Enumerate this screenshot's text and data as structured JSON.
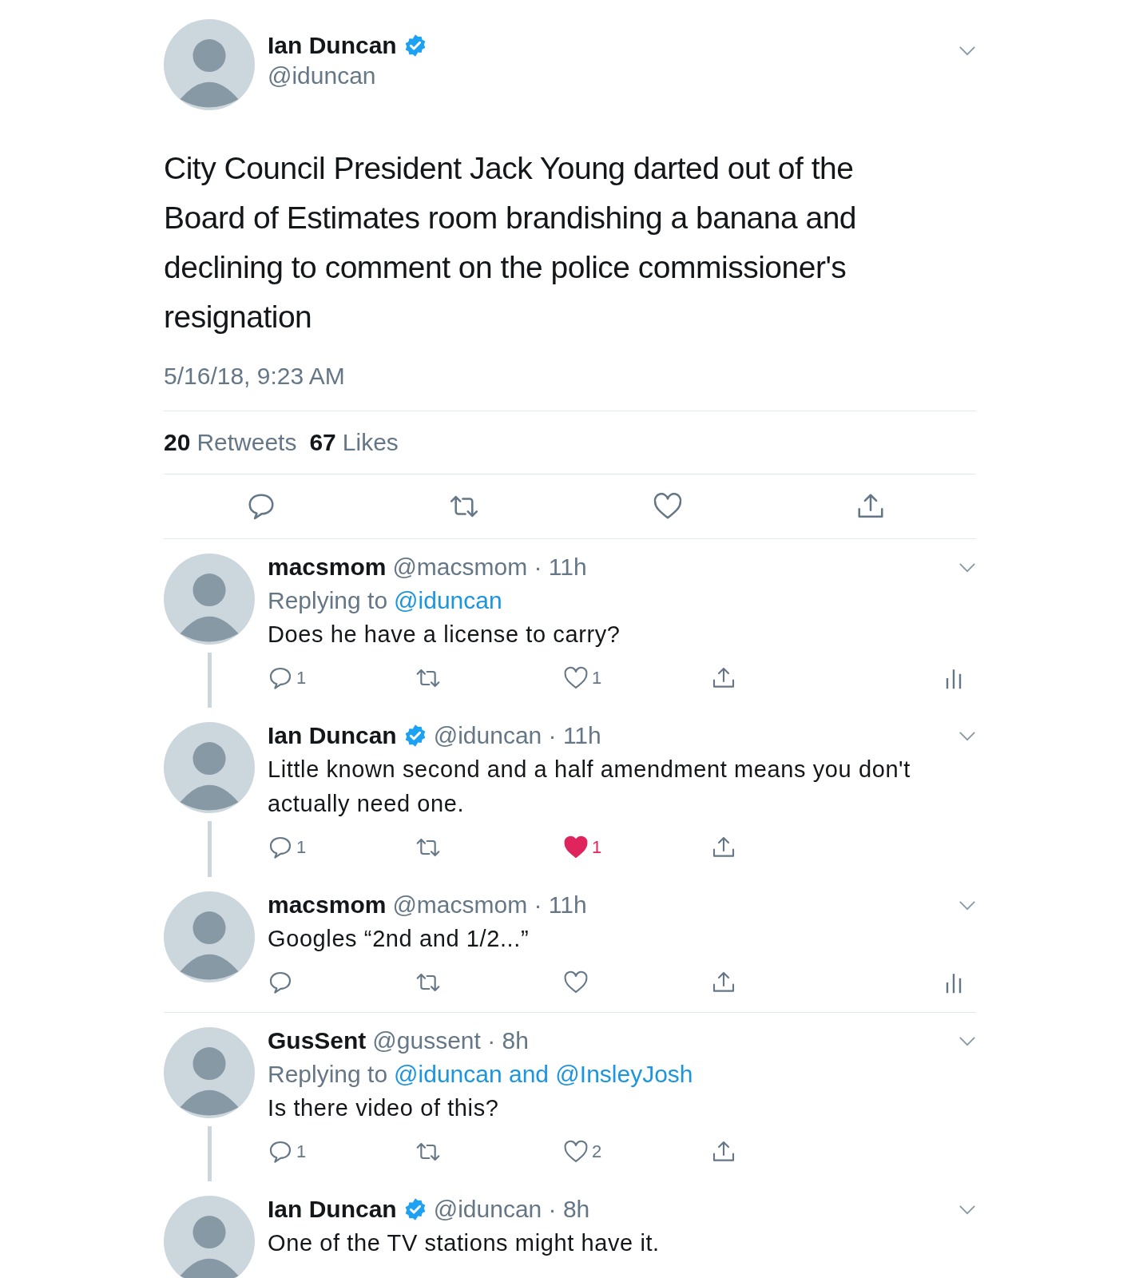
{
  "main_tweet": {
    "name": "Ian Duncan",
    "verified": true,
    "handle": "@iduncan",
    "text": "City Council President Jack Young darted out of the Board of Estimates room brandishing a banana and declining to comment on the police commissioner's resignation",
    "timestamp": "5/16/18, 9:23 AM",
    "stats": [
      {
        "count": "20",
        "label": "Retweets"
      },
      {
        "count": "67",
        "label": "Likes"
      }
    ],
    "actions": [
      {
        "kind": "reply"
      },
      {
        "kind": "retweet"
      },
      {
        "kind": "like",
        "liked": false
      },
      {
        "kind": "share"
      }
    ]
  },
  "threads": [
    {
      "tweets": [
        {
          "name": "macsmom",
          "verified": false,
          "meta": "@macsmom · 11h",
          "replying_to": {
            "prefix": "Replying to",
            "users": "@iduncan"
          },
          "text": "Does he have a license to carry?",
          "analytics": true,
          "actions": [
            {
              "kind": "reply",
              "count": "1"
            },
            {
              "kind": "retweet"
            },
            {
              "kind": "like",
              "liked": false,
              "count": "1"
            },
            {
              "kind": "share"
            }
          ]
        },
        {
          "name": "Ian Duncan",
          "verified": true,
          "meta": "@iduncan · 11h",
          "text": "Little known second and a half amendment means you don't actually need one.",
          "analytics": false,
          "actions": [
            {
              "kind": "reply",
              "count": "1"
            },
            {
              "kind": "retweet"
            },
            {
              "kind": "like",
              "liked": true,
              "count": "1"
            },
            {
              "kind": "share"
            }
          ]
        },
        {
          "name": "macsmom",
          "verified": false,
          "meta": "@macsmom · 11h",
          "text": "Googles “2nd and 1/2...”",
          "analytics": true,
          "actions": [
            {
              "kind": "reply"
            },
            {
              "kind": "retweet"
            },
            {
              "kind": "like",
              "liked": false
            },
            {
              "kind": "share"
            }
          ]
        }
      ]
    },
    {
      "tweets": [
        {
          "name": "GusSent",
          "verified": false,
          "meta": "@gussent · 8h",
          "replying_to": {
            "prefix": "Replying to",
            "users": "@iduncan and @InsleyJosh"
          },
          "text": "Is there video of this?",
          "analytics": false,
          "actions": [
            {
              "kind": "reply",
              "count": "1"
            },
            {
              "kind": "retweet"
            },
            {
              "kind": "like",
              "liked": false,
              "count": "2"
            },
            {
              "kind": "share"
            }
          ]
        },
        {
          "name": "Ian Duncan",
          "verified": true,
          "meta": "@iduncan · 8h",
          "text": "One of the TV stations might have it."
        }
      ]
    }
  ]
}
